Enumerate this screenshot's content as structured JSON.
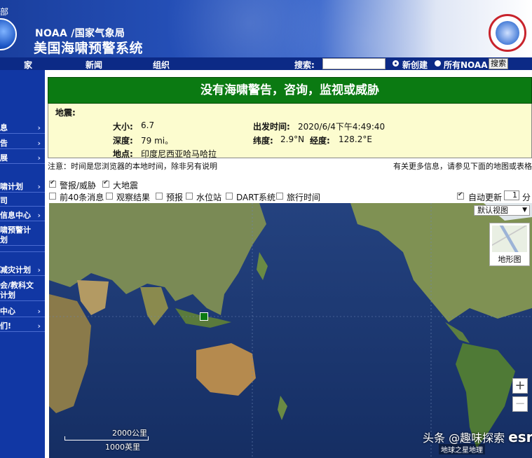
{
  "header": {
    "dept_fragment": "部",
    "title_line1": "NOAA /国家气象局",
    "title_line2": "美国海啸预警系统",
    "nws_logo_text": "NATIONAL WEATHER SERVICE"
  },
  "nav": {
    "home": "家",
    "news": "新闻",
    "org": "组织",
    "search_label": "搜索:",
    "search_value": "",
    "radio_new": "新创建",
    "radio_all": "所有NOAA",
    "search_button": "搜索"
  },
  "sidebar": {
    "items": [
      {
        "label": "息",
        "arrow": "›"
      },
      {
        "label": "告",
        "arrow": "›"
      },
      {
        "label": "展",
        "arrow": "›"
      },
      {
        "label": "啸计划",
        "arrow": "›"
      },
      {
        "label": "司",
        "arrow": ""
      },
      {
        "label": "信息中心",
        "arrow": "›"
      },
      {
        "label": "啸预警计",
        "arrow": ""
      },
      {
        "label": "划",
        "arrow": ""
      },
      {
        "label": "",
        "arrow": ""
      },
      {
        "label": "减灾计划",
        "arrow": "›"
      },
      {
        "label": "会/教科文",
        "arrow": ""
      },
      {
        "label": "计划",
        "arrow": ""
      },
      {
        "label": "中心",
        "arrow": "›"
      },
      {
        "label": "们!",
        "arrow": "›"
      }
    ]
  },
  "alert": {
    "banner": "没有海啸警告，咨询，监视或威胁"
  },
  "earthquake": {
    "heading": "地震:",
    "magnitude_label": "大小:",
    "magnitude": "6.7",
    "depth_label": "深度:",
    "depth": "79 mi。",
    "location_label": "地点:",
    "location": "印度尼西亚哈马哈拉",
    "time_label": "出发时间:",
    "time": "2020/6/4下午4:49:40",
    "lat_label": "纬度:",
    "lat": "2.9°N",
    "lon_label": "经度:",
    "lon": "128.2°E"
  },
  "notes": {
    "left": "注意：时间是您浏览器的本地时间，除非另有说明",
    "right": "有关更多信息，请参见下面的地图或表格"
  },
  "layers": {
    "row1": [
      {
        "label": "警报/威胁",
        "checked": true
      },
      {
        "label": "大地震",
        "checked": true
      }
    ],
    "row2": [
      {
        "label": "前40条消息",
        "checked": false
      },
      {
        "label": "观察结果",
        "checked": false
      },
      {
        "label": "预报",
        "checked": false
      },
      {
        "label": "水位站",
        "checked": false
      },
      {
        "label": "DART系统",
        "checked": false
      },
      {
        "label": "旅行时间",
        "checked": false
      }
    ],
    "auto_update_label": "自动更新",
    "auto_update_value": "1",
    "auto_update_unit": "分"
  },
  "map": {
    "view_select": "默认视图",
    "terrain_label": "地形图",
    "zoom_in": "+",
    "zoom_out": "−",
    "scale_km": "2000公里",
    "scale_mi": "1000英里",
    "attribution": "地球之星地理",
    "watermark": "头条 @趣味探索",
    "brand_fragment": "esri"
  }
}
